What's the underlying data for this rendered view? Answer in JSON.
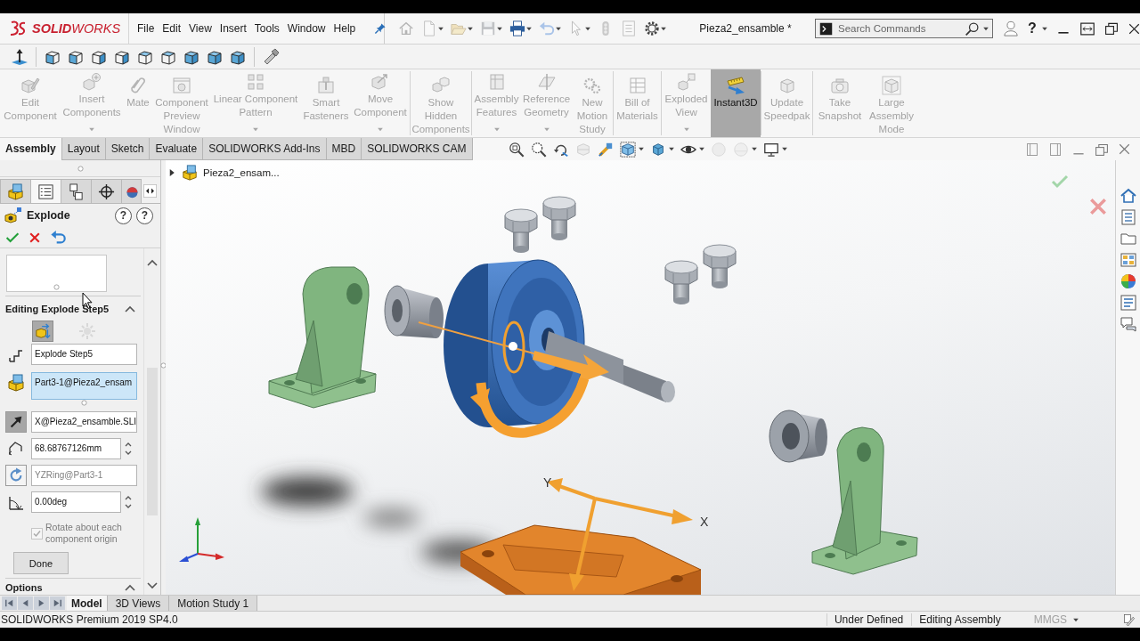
{
  "app": {
    "logo": "**SOLID**WORKS"
  },
  "menu": [
    "File",
    "Edit",
    "View",
    "Insert",
    "Tools",
    "Window",
    "Help"
  ],
  "quick_access": [
    {
      "disabled": true,
      "dropdown": false
    },
    {
      "disabled": true,
      "dropdown": true
    },
    {
      "disabled": true,
      "dropdown": true
    },
    {
      "disabled": true,
      "dropdown": true
    },
    {
      "disabled": false,
      "dropdown": true
    },
    {
      "disabled": true,
      "dropdown": true
    },
    {
      "disabled": true,
      "dropdown": true
    },
    {
      "disabled": true,
      "dropdown": false
    },
    {
      "disabled": true,
      "dropdown": false
    },
    {
      "disabled": false,
      "dropdown": true
    }
  ],
  "document_title": "Pieza2_ensamble *",
  "search": {
    "placeholder": "Search Commands"
  },
  "help_button": "?",
  "command_manager": {
    "groups": [
      {
        "buttons": [
          {
            "label": "Edit Component",
            "disabled": true,
            "selected": false,
            "dropdown": false
          },
          {
            "label": "Insert Components",
            "disabled": true,
            "selected": false,
            "dropdown": true
          },
          {
            "label": "Mate",
            "disabled": true,
            "selected": false,
            "dropdown": false
          },
          {
            "label": "Component Preview Window",
            "disabled": true,
            "selected": false,
            "dropdown": false
          },
          {
            "label": "Linear Component Pattern",
            "disabled": true,
            "selected": false,
            "dropdown": true
          },
          {
            "label": "Smart Fasteners",
            "disabled": true,
            "selected": false,
            "dropdown": false
          },
          {
            "label": "Move Component",
            "disabled": true,
            "selected": false,
            "dropdown": true
          }
        ]
      },
      {
        "buttons": [
          {
            "label": "Show Hidden Components",
            "disabled": true,
            "selected": false,
            "dropdown": false
          }
        ]
      },
      {
        "buttons": [
          {
            "label": "Assembly Features",
            "disabled": true,
            "selected": false,
            "dropdown": true
          },
          {
            "label": "Reference Geometry",
            "disabled": true,
            "selected": false,
            "dropdown": true
          },
          {
            "label": "New Motion Study",
            "disabled": true,
            "selected": false,
            "dropdown": false
          }
        ]
      },
      {
        "buttons": [
          {
            "label": "Bill of Materials",
            "disabled": true,
            "selected": false,
            "dropdown": false
          }
        ]
      },
      {
        "buttons": [
          {
            "label": "Exploded View",
            "disabled": true,
            "selected": false,
            "dropdown": true
          },
          {
            "label": "Instant3D",
            "disabled": false,
            "selected": true,
            "dropdown": false
          }
        ]
      },
      {
        "buttons": [
          {
            "label": "Update Speedpak",
            "disabled": true,
            "selected": false,
            "dropdown": false
          }
        ]
      },
      {
        "buttons": [
          {
            "label": "Take Snapshot",
            "disabled": true,
            "selected": false,
            "dropdown": false
          },
          {
            "label": "Large Assembly Mode",
            "disabled": true,
            "selected": false,
            "dropdown": false
          }
        ]
      }
    ]
  },
  "command_tabs": [
    {
      "label": "Assembly",
      "selected": true
    },
    {
      "label": "Layout",
      "selected": false
    },
    {
      "label": "Sketch",
      "selected": false
    },
    {
      "label": "Evaluate",
      "selected": false
    },
    {
      "label": "SOLIDWORKS Add-Ins",
      "selected": false
    },
    {
      "label": "MBD",
      "selected": false
    },
    {
      "label": "SOLIDWORKS CAM",
      "selected": false
    }
  ],
  "view_toolbar": [
    {
      "disabled": false,
      "dropdown": false
    },
    {
      "disabled": false,
      "dropdown": false
    },
    {
      "disabled": false,
      "dropdown": false
    },
    {
      "disabled": true,
      "dropdown": false
    },
    {
      "disabled": false,
      "dropdown": false
    },
    {
      "disabled": false,
      "dropdown": true
    },
    {
      "disabled": false,
      "dropdown": true
    },
    {
      "disabled": false,
      "dropdown": true
    },
    {
      "disabled": true,
      "dropdown": false
    },
    {
      "disabled": true,
      "dropdown": true
    },
    {
      "disabled": false,
      "dropdown": true
    }
  ],
  "property_manager": {
    "tabs": [
      {
        "selected": false
      },
      {
        "selected": true
      },
      {
        "selected": false
      },
      {
        "selected": false
      },
      {
        "selected": false
      }
    ],
    "title": "Explode",
    "help_buttons": [
      "?",
      "?"
    ],
    "section": {
      "title": "Editing Explode Step5",
      "expanded": true,
      "modes": [
        {
          "selected": true
        },
        {
          "selected": false
        }
      ]
    },
    "fields": [
      {
        "kind": "text",
        "value": "Explode Step5",
        "active": false,
        "disabled": false
      },
      {
        "kind": "list",
        "value": "Part3-1@Pieza2_ensam",
        "active": true,
        "disabled": false
      },
      {
        "kind": "selection",
        "value": "X@Pieza2_ensamble.SLI",
        "active": false,
        "disabled": false,
        "reverse_button": {
          "pressed": true
        }
      },
      {
        "kind": "spinner",
        "value": "68.68767126mm",
        "active": false,
        "disabled": false
      },
      {
        "kind": "selection",
        "value": "YZRing@Part3-1",
        "active": false,
        "disabled": true,
        "reverse_button": {
          "pressed": false
        }
      },
      {
        "kind": "spinner",
        "value": "0.00deg",
        "active": false,
        "disabled": false
      }
    ],
    "checkbox": {
      "label": "Rotate about each component origin",
      "checked": true,
      "disabled": true
    },
    "done_button": "Done",
    "next_section": {
      "title": "Options",
      "expanded": true
    }
  },
  "viewport": {
    "tree_flyout": {
      "label": "Pieza2_ensam...",
      "expanded": false
    },
    "triad_labels": [
      "Y",
      "X"
    ]
  },
  "bottom_tabs": [
    {
      "label": "Model",
      "selected": true
    },
    {
      "label": "3D Views",
      "selected": false
    },
    {
      "label": "Motion Study 1",
      "selected": false
    }
  ],
  "status_bar": {
    "product": "SOLIDWORKS Premium 2019 SP4.0",
    "items": [
      "Under Defined",
      "Editing Assembly"
    ],
    "units": "MMGS"
  }
}
